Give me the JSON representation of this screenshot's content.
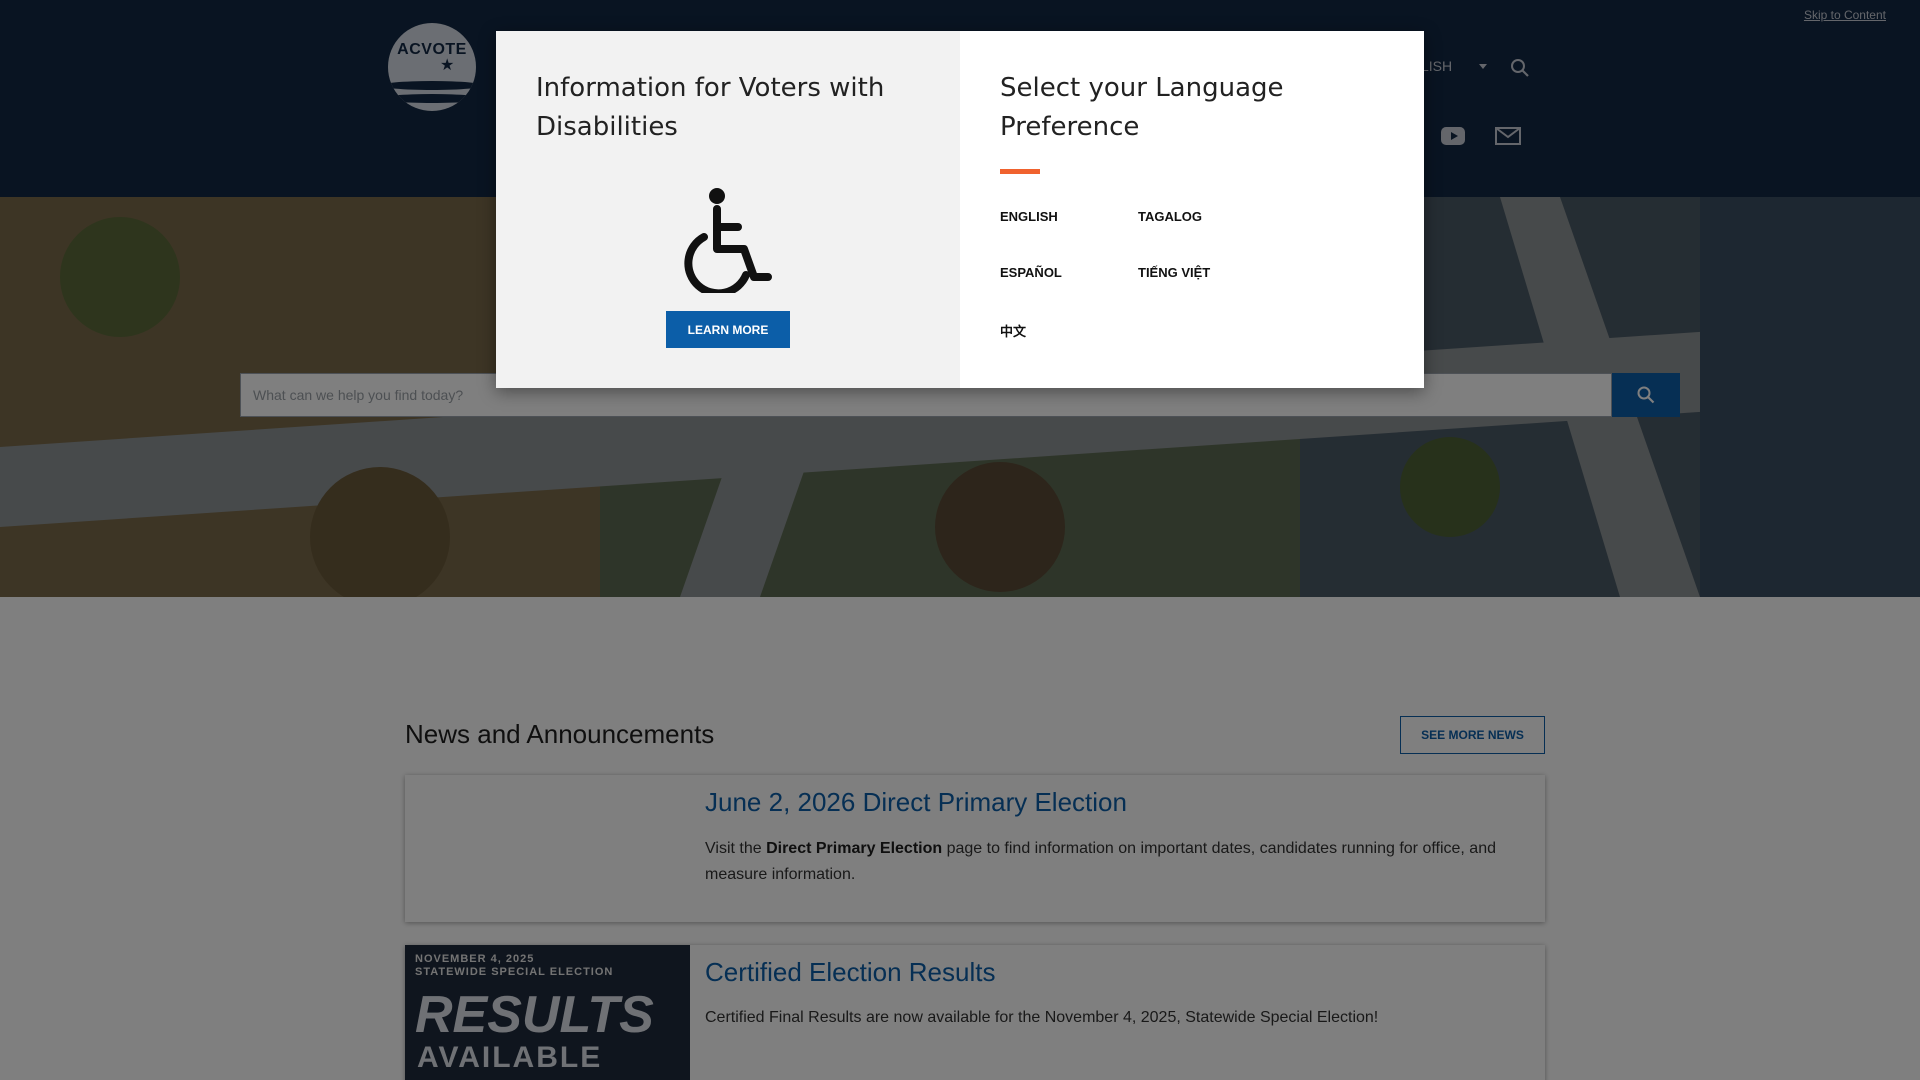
{
  "header": {
    "skip_link": "Skip to Content",
    "logo_text": "ACVOTE",
    "language_label": "NGLISH"
  },
  "hero": {
    "search_placeholder": "What can we help you find today?"
  },
  "news": {
    "title": "News and Announcements",
    "see_more_label": "SEE MORE NEWS",
    "cards": [
      {
        "title": "June 2, 2026 Direct Primary Election",
        "text_prefix": "Visit the ",
        "text_bold": "Direct Primary Election",
        "text_suffix": " page to find information on important dates, candidates running for office, and measure information."
      },
      {
        "title": "Certified Election Results",
        "text": "Certified Final Results are now available for the November 4, 2025, Statewide Special Election!",
        "thumb_line1": "NOVEMBER 4, 2025",
        "thumb_line2": "STATEWIDE SPECIAL ELECTION",
        "thumb_results": "RESULTS",
        "thumb_available": "AVAILABLE"
      }
    ]
  },
  "modal": {
    "disabilities_heading": "Information for Voters with Disabilities",
    "learn_more_label": "LEARN MORE",
    "language_heading": "Select your Language Preference",
    "languages": [
      "ENGLISH",
      "TAGALOG",
      "ESPAÑOL",
      "TIẾNG VIỆT",
      "中文"
    ]
  },
  "colors": {
    "header_bg": "#132844",
    "primary_blue": "#0c5ea8",
    "accent_orange": "#f0622e"
  }
}
